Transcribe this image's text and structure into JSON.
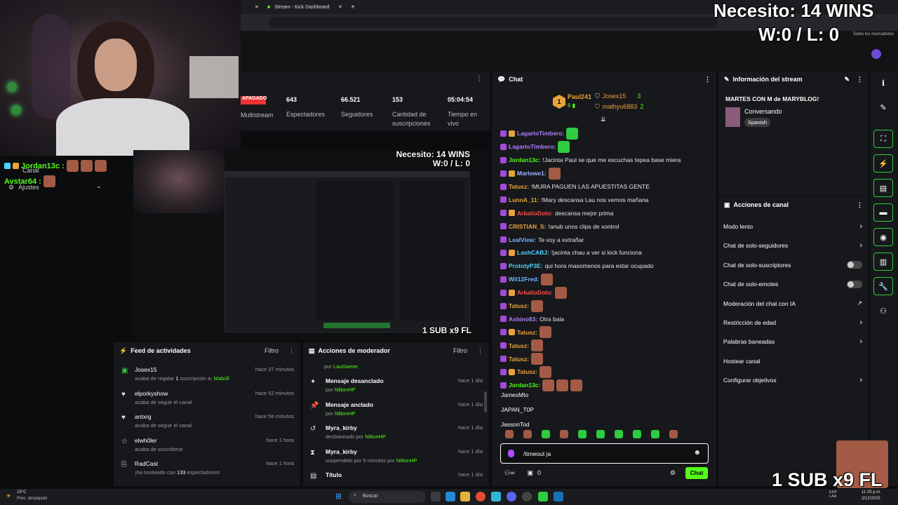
{
  "browser": {
    "tab_title": "Stream - Kick Dashboard",
    "bookmarks_label": "Todos los marcadores"
  },
  "overlay": {
    "goal_line1": "Necesito: 14 WINS",
    "goal_line2": "W:0 / L: 0",
    "sub_promo": "1 SUB x9 FL"
  },
  "cam_chat": {
    "user1": "Jordan13c :",
    "label_canal": "Canal",
    "user2": "Avstar64 :",
    "label_ajustes": "Ajustes"
  },
  "stats": {
    "offline_label": "APAGADO",
    "multistream_label": "Multistream",
    "items": [
      {
        "value": "643",
        "label": "Espectadores"
      },
      {
        "value": "66.521",
        "label": "Seguidores"
      },
      {
        "value": "153",
        "label": "Cantidad de suscripciones"
      },
      {
        "value": "05:04:54",
        "label": "Tiempo en vivo"
      }
    ]
  },
  "preview": {
    "goal_line1": "Necesito: 14 WINS",
    "goal_line2": "W:0 / L: 0",
    "sub_promo": "1 SUB x9 FL"
  },
  "chat": {
    "title": "Chat",
    "leaderboard": [
      {
        "rank": "1",
        "name": "Paul241",
        "count": "6"
      },
      {
        "rank": "",
        "name": "Josex15",
        "count": "3"
      },
      {
        "rank": "",
        "name": "mathyu6883",
        "count": "2"
      }
    ],
    "messages": [
      {
        "user": "LagartoTimbero:",
        "color": "#b07cff",
        "text": ""
      },
      {
        "user": "LagartoTimbero:",
        "color": "#b07cff",
        "text": ""
      },
      {
        "user": "Jordan13c:",
        "color": "#53fc18",
        "text": "!Jacinta Paul se que me escuchas tepea base miera"
      },
      {
        "user": "Marlowe1:",
        "color": "#9db7ff",
        "text": ""
      },
      {
        "user": "Tatusz:",
        "color": "#e8a33c",
        "text": "!MURA PAGUEN LAS APUESTITAS GENTE"
      },
      {
        "user": "LunnA_11:",
        "color": "#e8a33c",
        "text": "!Mary descansa Lau nos vemos mañana"
      },
      {
        "user": "ArkalioDoto:",
        "color": "#ff4d4d",
        "text": "descansa mejor prima"
      },
      {
        "user": "CRISTIAN_S:",
        "color": "#e8a33c",
        "text": "!anub unos clips de xontrol"
      },
      {
        "user": "LealView:",
        "color": "#6fb6ff",
        "text": "Te voy a extrañar"
      },
      {
        "user": "LashCABJ:",
        "color": "#4fd0ff",
        "text": "!jacinta chau a ver si kick funciona"
      },
      {
        "user": "PrototyP3E:",
        "color": "#4fd0ff",
        "text": "qui hora masomenos para estar ocupado"
      },
      {
        "user": "Wil12Fred:",
        "color": "#6fb6ff",
        "text": ""
      },
      {
        "user": "ArkalioDoto:",
        "color": "#ff4d4d",
        "text": ""
      },
      {
        "user": "Tatusz:",
        "color": "#e8a33c",
        "text": ""
      },
      {
        "user": "Ashino83:",
        "color": "#b07cff",
        "text": "Otra bala"
      },
      {
        "user": "Tatusz:",
        "color": "#e8a33c",
        "text": ""
      },
      {
        "user": "Tatusz:",
        "color": "#e8a33c",
        "text": ""
      },
      {
        "user": "Tatusz:",
        "color": "#e8a33c",
        "text": ""
      },
      {
        "user": "Tatusz:",
        "color": "#e8a33c",
        "text": ""
      },
      {
        "user": "Jordan13c:",
        "color": "#53fc18",
        "text": ""
      }
    ],
    "autocomplete": [
      "JamesMto",
      "JAPAN_T0P",
      "JassonTod"
    ],
    "input_value": "/timeout ja",
    "counter": "0",
    "send_label": "Chat"
  },
  "stream_info": {
    "title": "Información del stream",
    "stream_title": "MARTES CON M de MARYBLOG!",
    "category": "Conversando",
    "language": "Spanish"
  },
  "channel_actions": {
    "title": "Acciones de canal",
    "items": [
      {
        "label": "Modo lento",
        "control": "chevron"
      },
      {
        "label": "Chat de solo-seguidores",
        "control": "chevron"
      },
      {
        "label": "Chat de solo-suscriptores",
        "control": "toggle"
      },
      {
        "label": "Chat de solo-emotes",
        "control": "toggle"
      },
      {
        "label": "Moderación del chat con IA",
        "control": "chart"
      },
      {
        "label": "Restricción de edad",
        "control": "chevron"
      },
      {
        "label": "Palabras baneadas",
        "control": "chevron"
      },
      {
        "label": "Hostear canal",
        "control": "none"
      },
      {
        "label": "Configurar objetivos",
        "control": "chevron"
      }
    ]
  },
  "activity_feed": {
    "title": "Feed de actividades",
    "filter_label": "Filtro",
    "items": [
      {
        "name": "Josex15",
        "pre": "acaba de regalar ",
        "num": "1",
        "mid": " suscripción a: ",
        "hl": "Mabi3l",
        "post": "",
        "time": "hace 37 minutos"
      },
      {
        "name": "elporkyshow",
        "pre": "acaba de seguir el canal",
        "num": "",
        "mid": "",
        "hl": "",
        "post": "",
        "time": "hace 52 minutos"
      },
      {
        "name": "antxrg",
        "pre": "acaba de seguir el canal",
        "num": "",
        "mid": "",
        "hl": "",
        "post": "",
        "time": "hace 56 minutos"
      },
      {
        "name": "elwh0ler",
        "pre": "acaba de suscribirse",
        "num": "",
        "mid": "",
        "hl": "",
        "post": "",
        "time": "hace 1 hora"
      },
      {
        "name": "RadCast",
        "pre": "¡ha hosteado con ",
        "num": "133",
        "mid": "",
        "hl": "",
        "post": " espectadores!",
        "time": "hace 1 hora"
      }
    ]
  },
  "mod_actions": {
    "title": "Acciones de moderador",
    "filter_label": "Filtro",
    "top_by": "por",
    "top_user": "LauGamer",
    "items": [
      {
        "action": "Mensaje desanclado",
        "by": "por",
        "user": "NiltonHP",
        "time": "hace 1 día"
      },
      {
        "action": "Mensaje anclado",
        "by": "por",
        "user": "NiltonHP",
        "time": "hace 1 día"
      },
      {
        "action": "Myra_kirby",
        "by": "desbaneado por",
        "user": "NiltonHP",
        "time": "hace 1 día"
      },
      {
        "action": "Myra_kirby",
        "by": "suspendido por 5 minutos por",
        "user": "NiltonHP",
        "time": "hace 1 día"
      },
      {
        "action": "Título",
        "by": "",
        "user": "",
        "time": "hace 1 día"
      }
    ]
  },
  "taskbar": {
    "weather_temp": "19°C",
    "weather_desc": "Prec. despejado",
    "search_label": "Buscar",
    "lang": "ESP LAA",
    "time": "11:29 p.m.",
    "date": "2/12/2025"
  }
}
